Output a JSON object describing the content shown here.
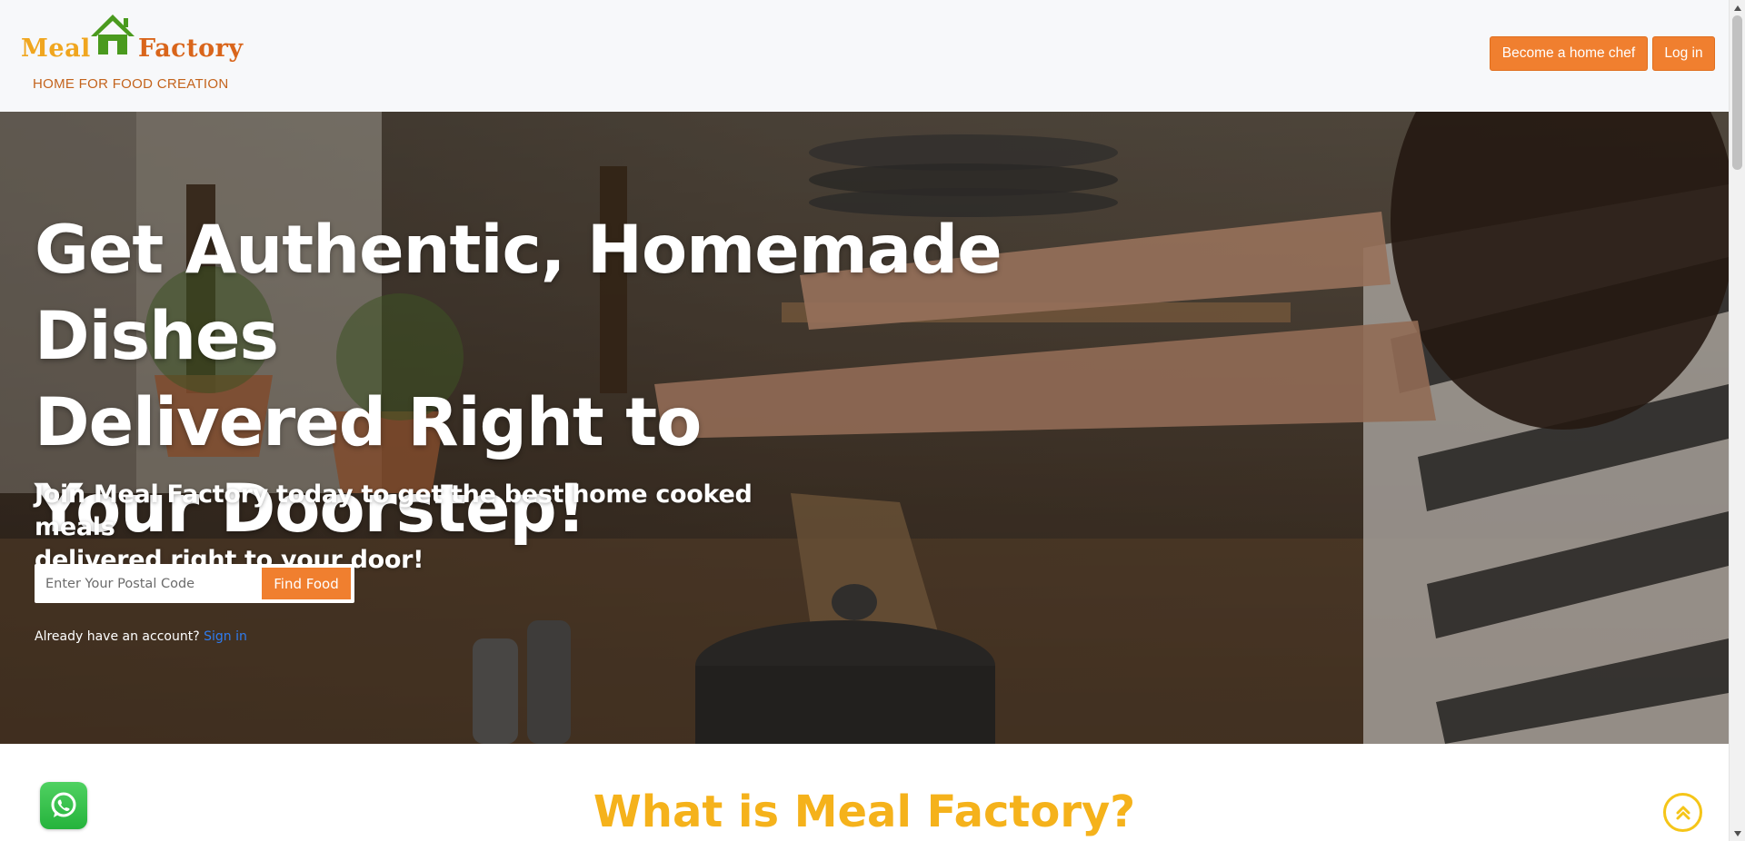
{
  "header": {
    "logo": {
      "word_left": "Meal",
      "word_right": "Factory",
      "tagline": "HOME FOR FOOD CREATION",
      "icon": "house-icon"
    },
    "buttons": {
      "become_chef": "Become a home chef",
      "login": "Log in"
    }
  },
  "hero": {
    "title_lines": [
      "Get Authentic, Homemade Dishes",
      "Delivered Right to",
      "Your Doorstep!"
    ],
    "subtitle_lines": [
      "Join Meal Factory today to get the best home cooked meals",
      "delivered right to your door!"
    ],
    "search": {
      "placeholder": "Enter Your Postal Code",
      "value": "",
      "button": "Find Food"
    },
    "account": {
      "prompt": "Already have an account?",
      "link": "Sign in"
    }
  },
  "section": {
    "title": "What is Meal Factory?"
  },
  "widgets": {
    "whatsapp_icon": "whatsapp-icon",
    "scroll_top_icon": "double-chevron-up-icon"
  },
  "colors": {
    "accent_orange": "#f07f2f",
    "logo_meal": "#f0a61f",
    "logo_factory": "#d9651b",
    "logo_house": "#4a9a1e",
    "section_title": "#f5b21b",
    "link_blue": "#2f7cf0",
    "whatsapp_green": "#25b33c"
  }
}
